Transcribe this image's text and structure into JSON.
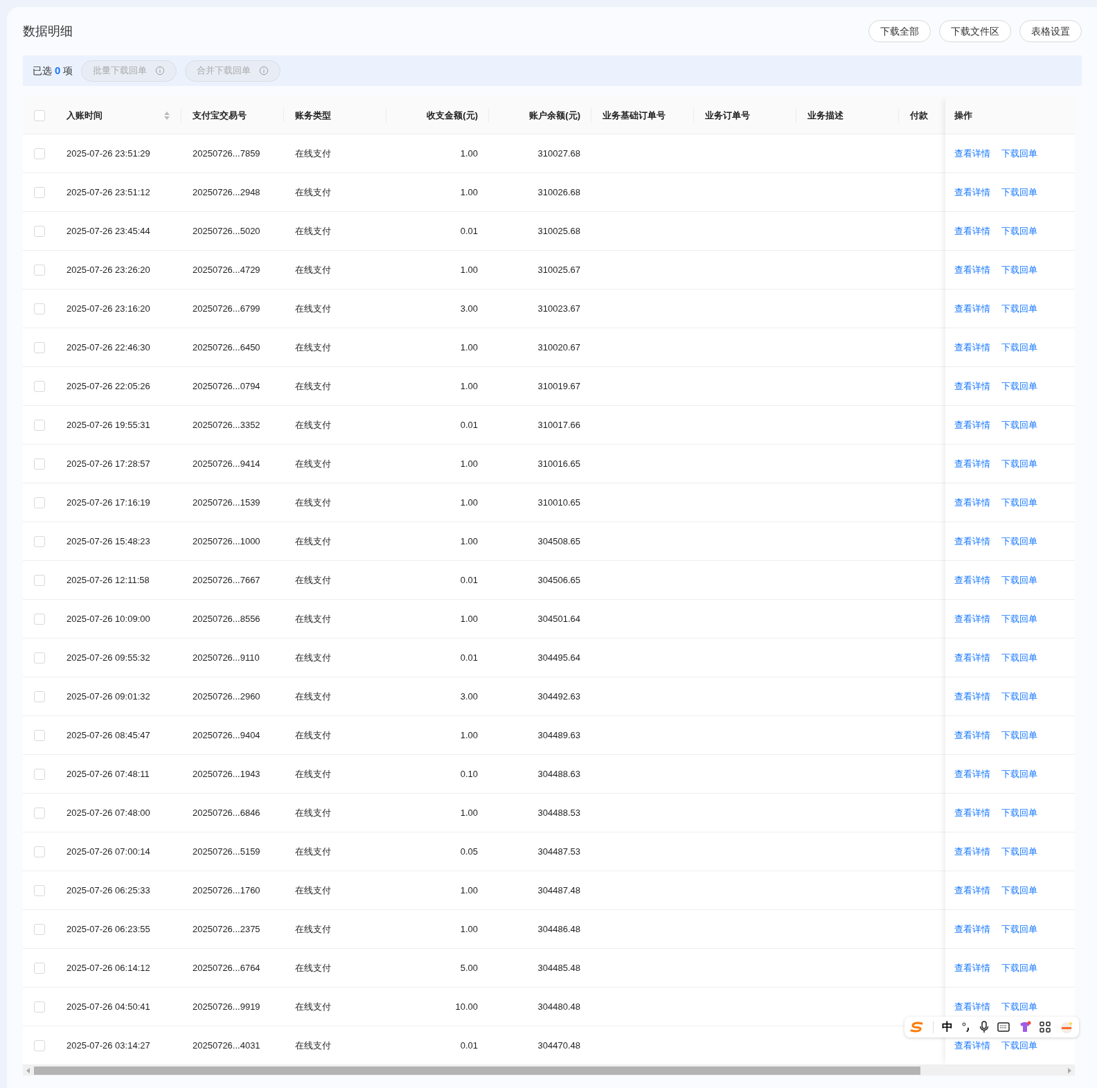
{
  "title": "数据明细",
  "header_buttons": [
    "下载全部",
    "下载文件区",
    "表格设置"
  ],
  "selection": {
    "prefix": "已选",
    "count": "0",
    "suffix": "项",
    "actions": [
      {
        "label": "批量下载回单",
        "disabled": true
      },
      {
        "label": "合并下载回单",
        "disabled": true
      }
    ]
  },
  "table": {
    "select_all_checked": false,
    "columns": [
      {
        "label": "入账时间",
        "kind": "sortable"
      },
      {
        "label": "支付宝交易号",
        "kind": "plain"
      },
      {
        "label": "账务类型",
        "kind": "plain"
      },
      {
        "label": "收支金额(元)",
        "kind": "plain"
      },
      {
        "label": "账户余额(元)",
        "kind": "plain"
      },
      {
        "label": "业务基础订单号",
        "kind": "plain"
      },
      {
        "label": "业务订单号",
        "kind": "plain"
      },
      {
        "label": "业务描述",
        "kind": "plain"
      },
      {
        "label": "付款",
        "kind": "plain"
      }
    ],
    "actions_column": "操作",
    "rows": [
      {
        "checked": false,
        "cells": [
          "2025-07-26 23:51:29",
          "20250726...7859",
          "在线支付",
          "1.00",
          "310027.68"
        ],
        "actions": [
          "查看详情",
          "下载回单"
        ]
      },
      {
        "checked": false,
        "cells": [
          "2025-07-26 23:51:12",
          "20250726...2948",
          "在线支付",
          "1.00",
          "310026.68"
        ],
        "actions": [
          "查看详情",
          "下载回单"
        ]
      },
      {
        "checked": false,
        "cells": [
          "2025-07-26 23:45:44",
          "20250726...5020",
          "在线支付",
          "0.01",
          "310025.68"
        ],
        "actions": [
          "查看详情",
          "下载回单"
        ]
      },
      {
        "checked": false,
        "cells": [
          "2025-07-26 23:26:20",
          "20250726...4729",
          "在线支付",
          "1.00",
          "310025.67"
        ],
        "actions": [
          "查看详情",
          "下载回单"
        ]
      },
      {
        "checked": false,
        "cells": [
          "2025-07-26 23:16:20",
          "20250726...6799",
          "在线支付",
          "3.00",
          "310023.67"
        ],
        "actions": [
          "查看详情",
          "下载回单"
        ]
      },
      {
        "checked": false,
        "cells": [
          "2025-07-26 22:46:30",
          "20250726...6450",
          "在线支付",
          "1.00",
          "310020.67"
        ],
        "actions": [
          "查看详情",
          "下载回单"
        ]
      },
      {
        "checked": false,
        "cells": [
          "2025-07-26 22:05:26",
          "20250726...0794",
          "在线支付",
          "1.00",
          "310019.67"
        ],
        "actions": [
          "查看详情",
          "下载回单"
        ]
      },
      {
        "checked": false,
        "cells": [
          "2025-07-26 19:55:31",
          "20250726...3352",
          "在线支付",
          "0.01",
          "310017.66"
        ],
        "actions": [
          "查看详情",
          "下载回单"
        ]
      },
      {
        "checked": false,
        "cells": [
          "2025-07-26 17:28:57",
          "20250726...9414",
          "在线支付",
          "1.00",
          "310016.65"
        ],
        "actions": [
          "查看详情",
          "下载回单"
        ]
      },
      {
        "checked": false,
        "cells": [
          "2025-07-26 17:16:19",
          "20250726...1539",
          "在线支付",
          "1.00",
          "310010.65"
        ],
        "actions": [
          "查看详情",
          "下载回单"
        ]
      },
      {
        "checked": false,
        "cells": [
          "2025-07-26 15:48:23",
          "20250726...1000",
          "在线支付",
          "1.00",
          "304508.65"
        ],
        "actions": [
          "查看详情",
          "下载回单"
        ]
      },
      {
        "checked": false,
        "cells": [
          "2025-07-26 12:11:58",
          "20250726...7667",
          "在线支付",
          "0.01",
          "304506.65"
        ],
        "actions": [
          "查看详情",
          "下载回单"
        ]
      },
      {
        "checked": false,
        "cells": [
          "2025-07-26 10:09:00",
          "20250726...8556",
          "在线支付",
          "1.00",
          "304501.64"
        ],
        "actions": [
          "查看详情",
          "下载回单"
        ]
      },
      {
        "checked": false,
        "cells": [
          "2025-07-26 09:55:32",
          "20250726...9110",
          "在线支付",
          "0.01",
          "304495.64"
        ],
        "actions": [
          "查看详情",
          "下载回单"
        ]
      },
      {
        "checked": false,
        "cells": [
          "2025-07-26 09:01:32",
          "20250726...2960",
          "在线支付",
          "3.00",
          "304492.63"
        ],
        "actions": [
          "查看详情",
          "下载回单"
        ]
      },
      {
        "checked": false,
        "cells": [
          "2025-07-26 08:45:47",
          "20250726...9404",
          "在线支付",
          "1.00",
          "304489.63"
        ],
        "actions": [
          "查看详情",
          "下载回单"
        ]
      },
      {
        "checked": false,
        "cells": [
          "2025-07-26 07:48:11",
          "20250726...1943",
          "在线支付",
          "0.10",
          "304488.63"
        ],
        "actions": [
          "查看详情",
          "下载回单"
        ]
      },
      {
        "checked": false,
        "cells": [
          "2025-07-26 07:48:00",
          "20250726...6846",
          "在线支付",
          "1.00",
          "304488.53"
        ],
        "actions": [
          "查看详情",
          "下载回单"
        ]
      },
      {
        "checked": false,
        "cells": [
          "2025-07-26 07:00:14",
          "20250726...5159",
          "在线支付",
          "0.05",
          "304487.53"
        ],
        "actions": [
          "查看详情",
          "下载回单"
        ]
      },
      {
        "checked": false,
        "cells": [
          "2025-07-26 06:25:33",
          "20250726...1760",
          "在线支付",
          "1.00",
          "304487.48"
        ],
        "actions": [
          "查看详情",
          "下载回单"
        ]
      },
      {
        "checked": false,
        "cells": [
          "2025-07-26 06:23:55",
          "20250726...2375",
          "在线支付",
          "1.00",
          "304486.48"
        ],
        "actions": [
          "查看详情",
          "下载回单"
        ]
      },
      {
        "checked": false,
        "cells": [
          "2025-07-26 06:14:12",
          "20250726...6764",
          "在线支付",
          "5.00",
          "304485.48"
        ],
        "actions": [
          "查看详情",
          "下载回单"
        ]
      },
      {
        "checked": false,
        "cells": [
          "2025-07-26 04:50:41",
          "20250726...9919",
          "在线支付",
          "10.00",
          "304480.48"
        ],
        "actions": [
          "查看详情",
          "下载回单"
        ]
      },
      {
        "checked": false,
        "cells": [
          "2025-07-26 03:14:27",
          "20250726...4031",
          "在线支付",
          "0.01",
          "304470.48"
        ],
        "actions": [
          "查看详情",
          "下载回单"
        ]
      }
    ]
  },
  "ime_toolbar": {
    "mode": "中"
  }
}
